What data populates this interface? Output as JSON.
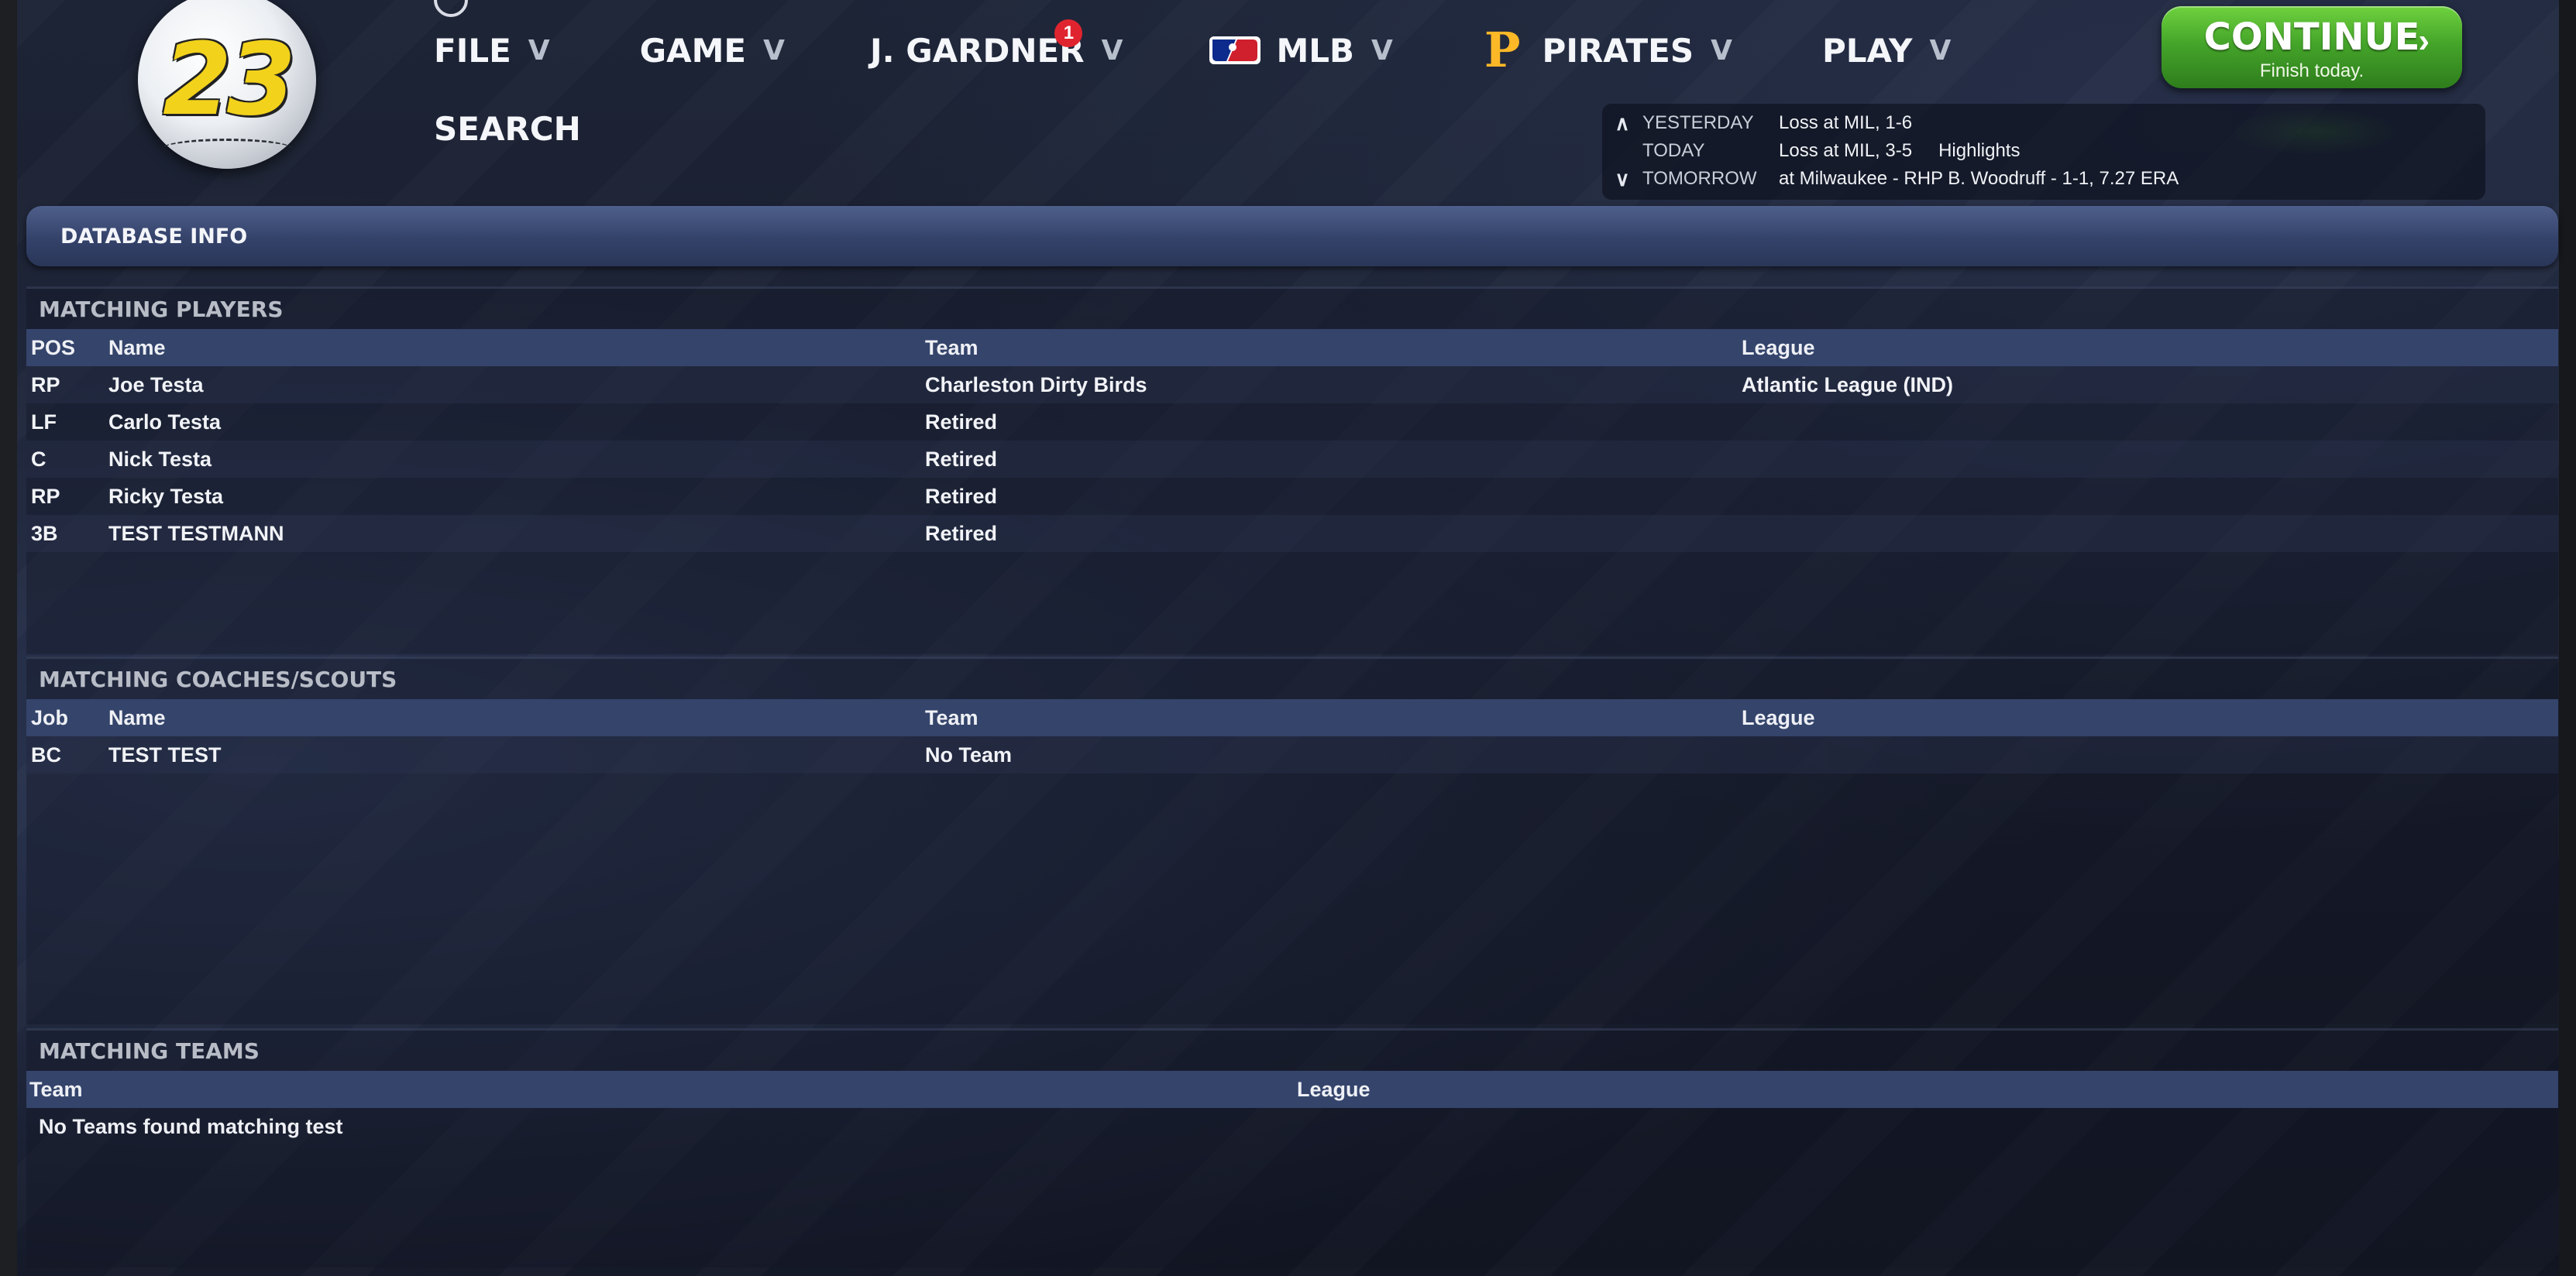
{
  "logo": {
    "number": "23"
  },
  "nav": {
    "file": "FILE",
    "game": "GAME",
    "manager": "J. GARDNER",
    "manager_badge": "1",
    "mlb": "MLB",
    "team": "PIRATES",
    "play": "PLAY",
    "search": "SEARCH",
    "chevron_icon": "chevron-down-icon"
  },
  "continue": {
    "label": "CONTINUE",
    "sublabel": "Finish today."
  },
  "schedule": {
    "yesterday": {
      "label": "YESTERDAY",
      "result": "Loss at MIL, 1-6"
    },
    "today": {
      "label": "TODAY",
      "result": "Loss at MIL, 3-5",
      "link": "Highlights"
    },
    "tomorrow": {
      "label": "TOMORROW",
      "result": "at Milwaukee - RHP B. Woodruff - 1-1, 7.27 ERA"
    }
  },
  "header": {
    "title": "DATABASE INFO"
  },
  "players": {
    "title": "MATCHING PLAYERS",
    "columns": [
      "POS",
      "Name",
      "Team",
      "League"
    ],
    "rows": [
      {
        "pos": "RP",
        "name": "Joe Testa",
        "team": "Charleston Dirty Birds",
        "league": "Atlantic League (IND)"
      },
      {
        "pos": "LF",
        "name": "Carlo Testa",
        "team": "Retired",
        "league": ""
      },
      {
        "pos": "C",
        "name": "Nick Testa",
        "team": "Retired",
        "league": ""
      },
      {
        "pos": "RP",
        "name": "Ricky Testa",
        "team": "Retired",
        "league": ""
      },
      {
        "pos": "3B",
        "name": "TEST TESTMANN",
        "team": "Retired",
        "league": ""
      }
    ]
  },
  "coaches": {
    "title": "MATCHING COACHES/SCOUTS",
    "columns": [
      "Job",
      "Name",
      "Team",
      "League"
    ],
    "rows": [
      {
        "job": "BC",
        "name": "TEST TEST",
        "team": "No Team",
        "league": ""
      }
    ]
  },
  "teams": {
    "title": "MATCHING TEAMS",
    "columns": [
      "Team",
      "League"
    ],
    "empty_message": "No Teams found matching test"
  },
  "colors": {
    "accent_green": "#45a52a",
    "header_blue": "#34446b",
    "badge_red": "#e0242f",
    "pirates_gold": "#fdb827",
    "logo_yellow": "#f2d21b"
  }
}
